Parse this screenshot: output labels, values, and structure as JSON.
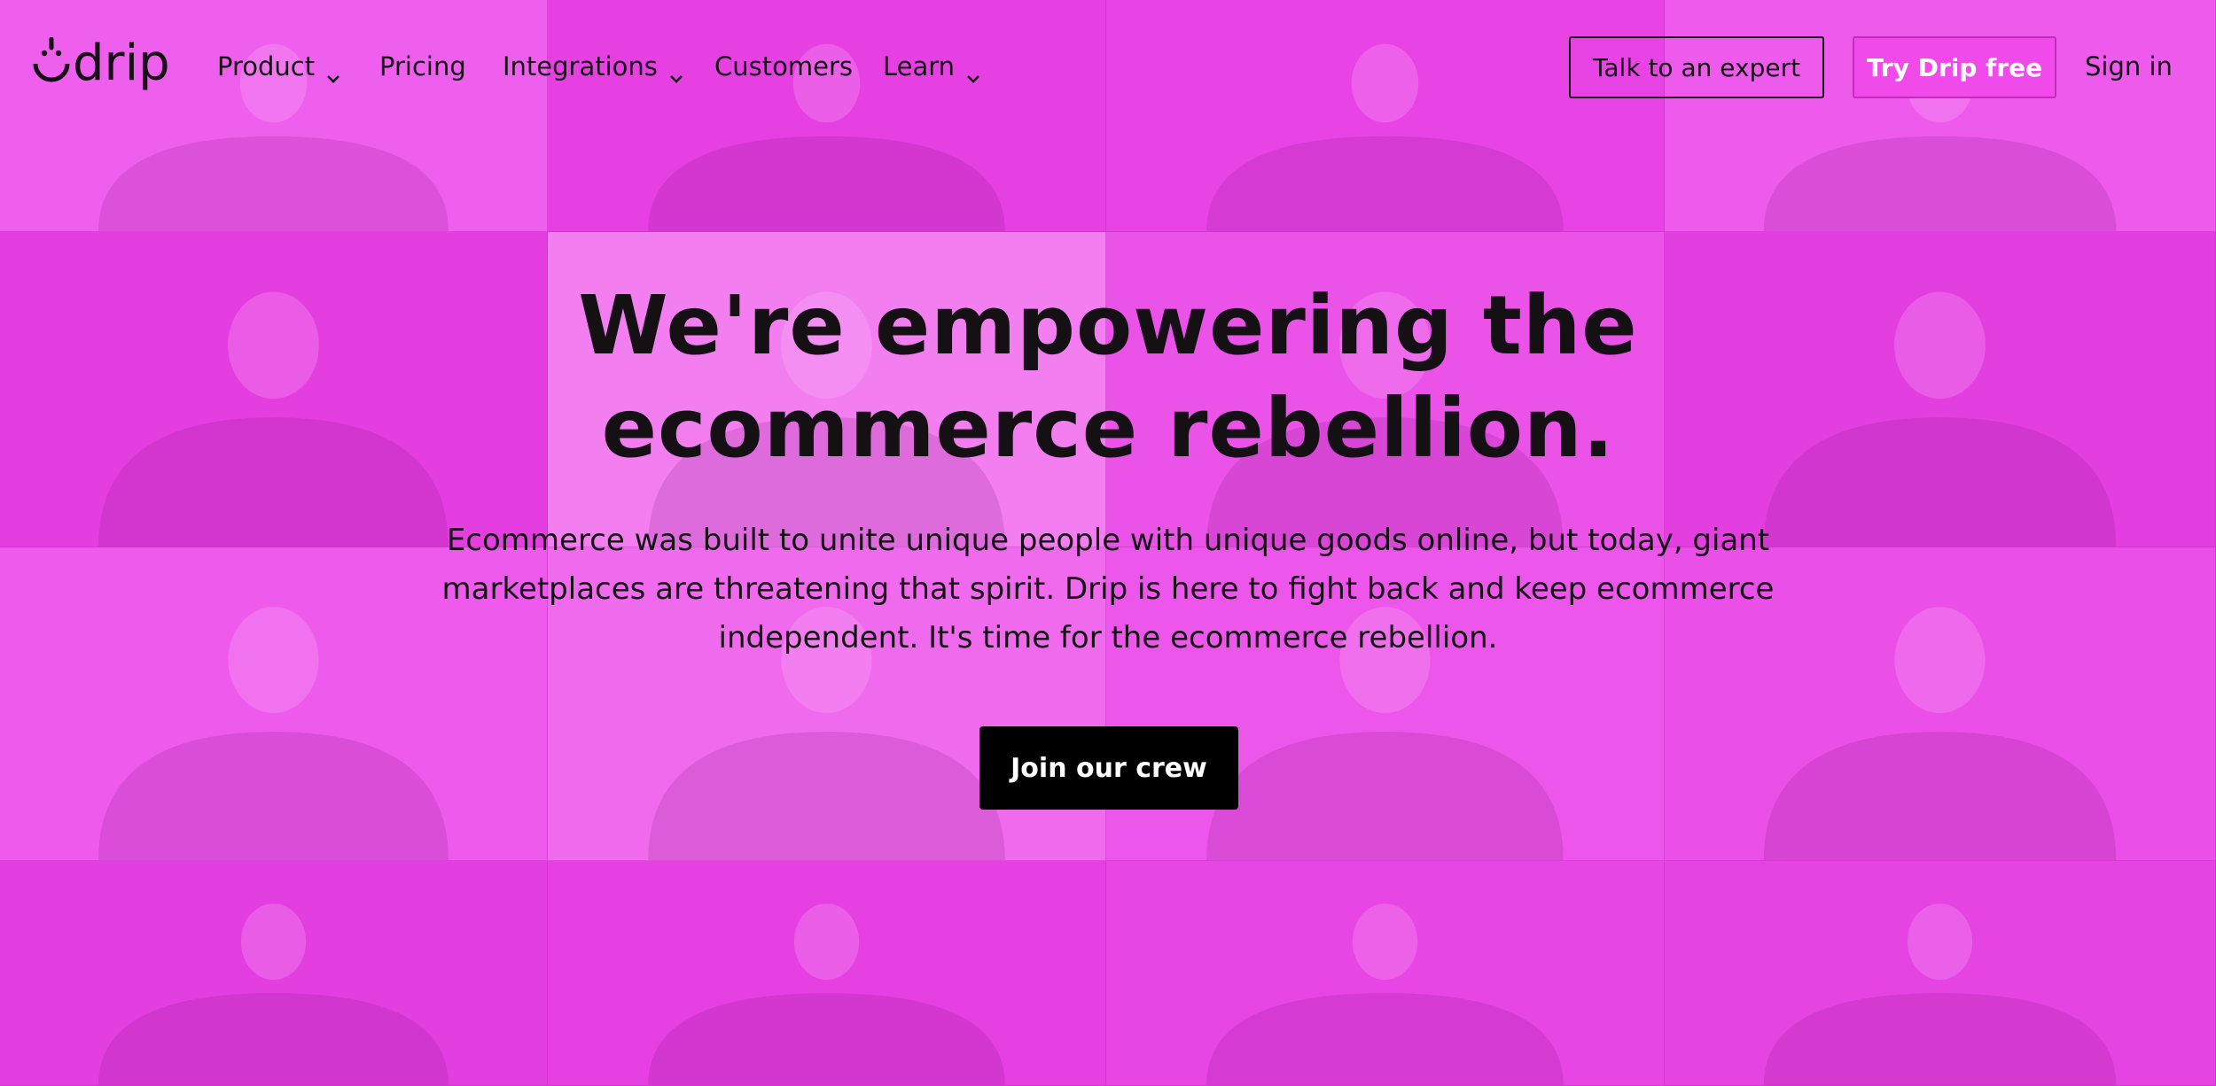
{
  "brand": {
    "name": "drip",
    "logo_icon": "drip-smile-icon",
    "colors": {
      "background": "#e33fe0",
      "accent_button": "#f04aea",
      "text": "#141014",
      "cta": "#000000"
    }
  },
  "nav": {
    "items": [
      {
        "label": "Product",
        "has_dropdown": true
      },
      {
        "label": "Pricing",
        "has_dropdown": false
      },
      {
        "label": "Integrations",
        "has_dropdown": true
      },
      {
        "label": "Customers",
        "has_dropdown": false
      },
      {
        "label": "Learn",
        "has_dropdown": true
      }
    ],
    "talk_label": "Talk to an expert",
    "try_label": "Try Drip free",
    "signin_label": "Sign in"
  },
  "hero": {
    "title_line1": "We're empowering the",
    "title_line2": "ecommerce rebellion.",
    "subtitle_line1": "Ecommerce was built to unite unique people with unique goods online, but today, giant",
    "subtitle_line2": "marketplaces are threatening that spirit. Drip is here to fight back and keep ecommerce",
    "subtitle_line3": "independent. It's time for the ecommerce rebellion.",
    "cta_label": "Join our crew"
  }
}
